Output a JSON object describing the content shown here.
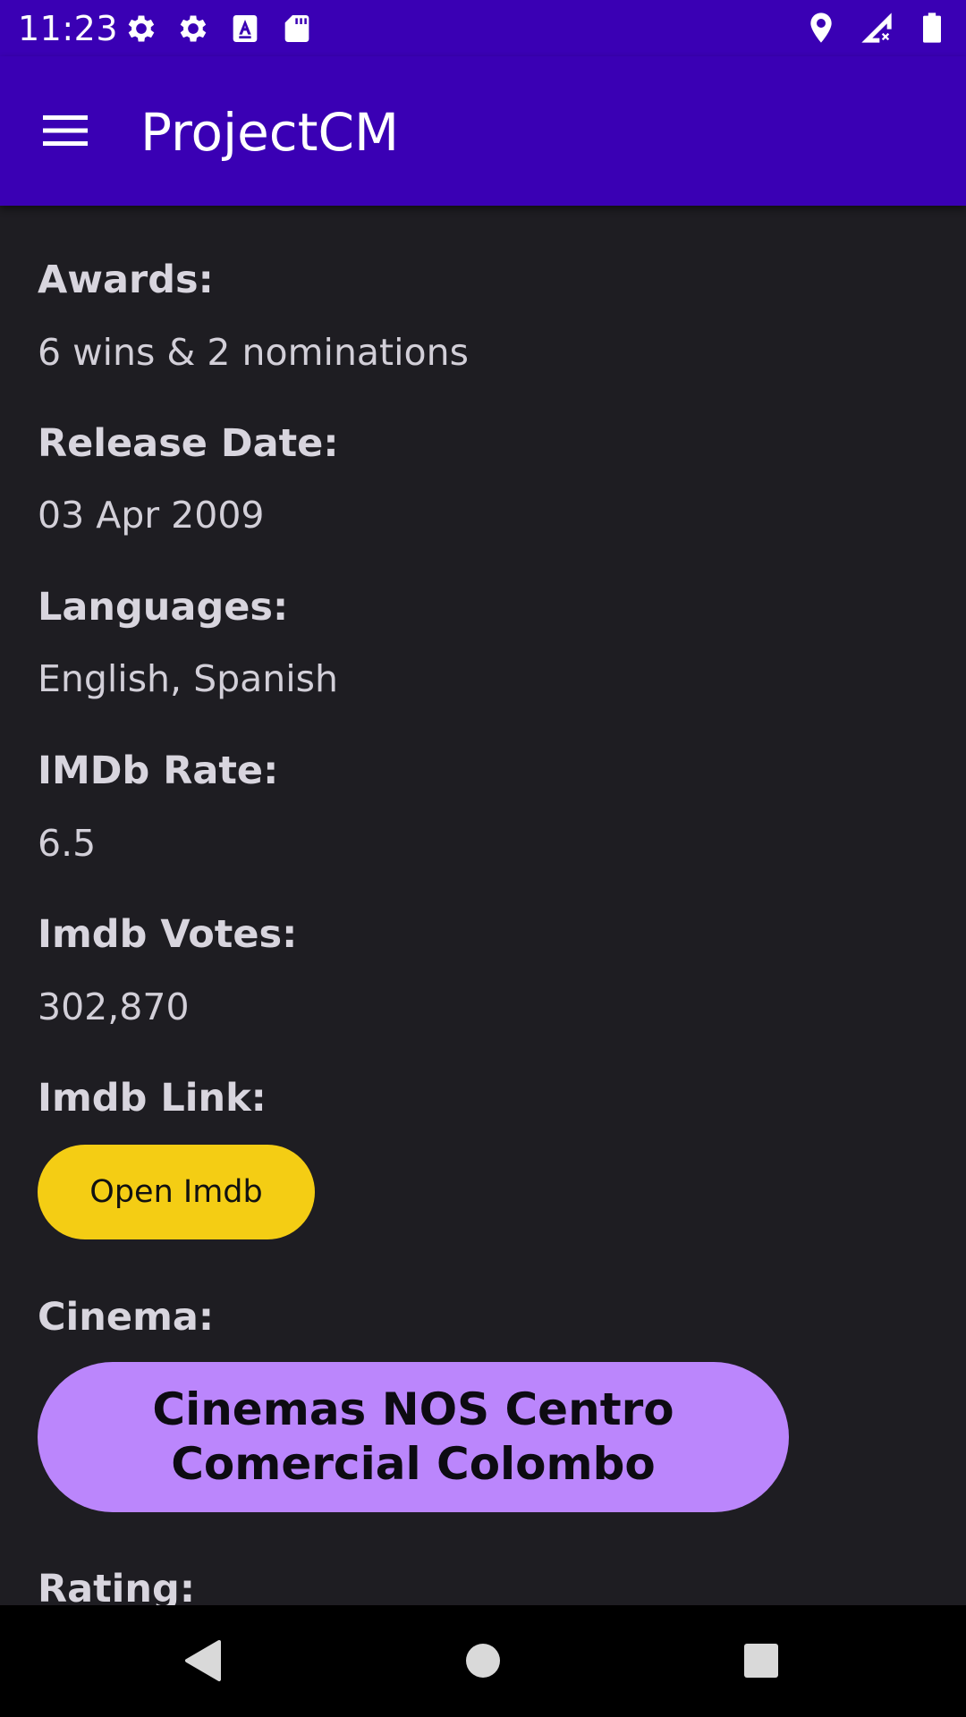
{
  "status_bar": {
    "time": "11:23",
    "left_icons": [
      "gear-icon",
      "gear-icon",
      "font-a-icon",
      "sd-card-icon"
    ],
    "right_icons": [
      "location-icon",
      "signal-icon",
      "battery-icon"
    ]
  },
  "app_bar": {
    "title": "ProjectCM",
    "menu_icon": "hamburger-menu-icon",
    "background": "#3a00b4"
  },
  "details": [
    {
      "label": "Awards:",
      "value": "6 wins & 2 nominations"
    },
    {
      "label": "Release Date:",
      "value": "03 Apr 2009"
    },
    {
      "label": "Languages:",
      "value": "English, Spanish"
    },
    {
      "label": "IMDb Rate:",
      "value": "6.5"
    },
    {
      "label": "Imdb Votes:",
      "value": "302,870"
    }
  ],
  "imdb_link": {
    "label": "Imdb Link:",
    "button_label": "Open Imdb",
    "button_color": "#f4cd14"
  },
  "cinema": {
    "label": "Cinema:",
    "button_label": "Cinemas NOS Centro Comercial Colombo",
    "button_color": "#bb86fc"
  },
  "rating": {
    "label": "Rating:"
  },
  "nav_bar": {
    "icons": [
      "back-triangle-icon",
      "home-circle-icon",
      "recents-square-icon"
    ]
  }
}
